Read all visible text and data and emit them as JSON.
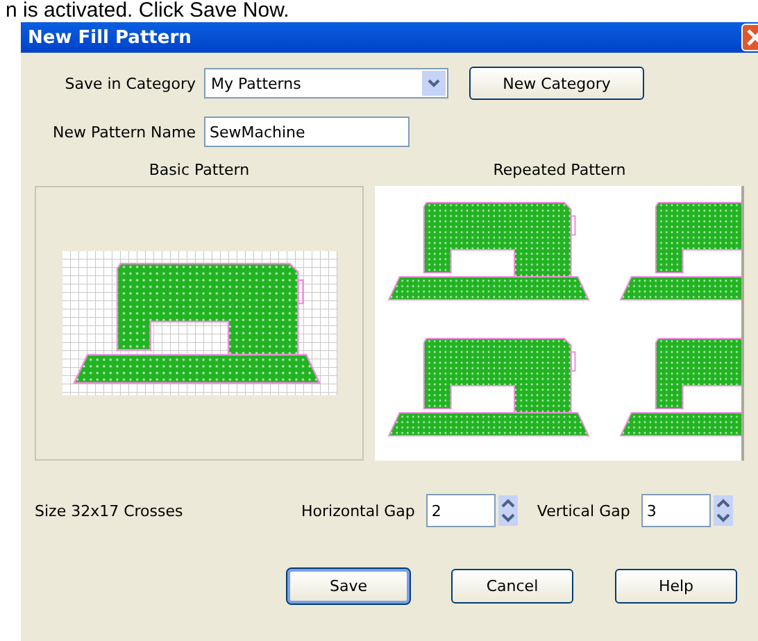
{
  "caption": "n is activated. Click Save Now.",
  "window": {
    "title": "New Fill Pattern"
  },
  "category": {
    "label": "Save in Category",
    "value": "My Patterns",
    "button": "New Category"
  },
  "name_field": {
    "label": "New Pattern Name",
    "value": "SewMachine"
  },
  "basic_pattern": {
    "heading": "Basic Pattern"
  },
  "repeated_pattern": {
    "heading": "Repeated Pattern"
  },
  "size_text": "Size 32x17 Crosses",
  "gaps": [
    {
      "label": "Horizontal Gap",
      "value": "2"
    },
    {
      "label": "Vertical Gap",
      "value": "3"
    }
  ],
  "buttons": [
    {
      "label": "Save",
      "default": true
    },
    {
      "label": "Cancel",
      "default": false
    },
    {
      "label": "Help",
      "default": false
    }
  ]
}
